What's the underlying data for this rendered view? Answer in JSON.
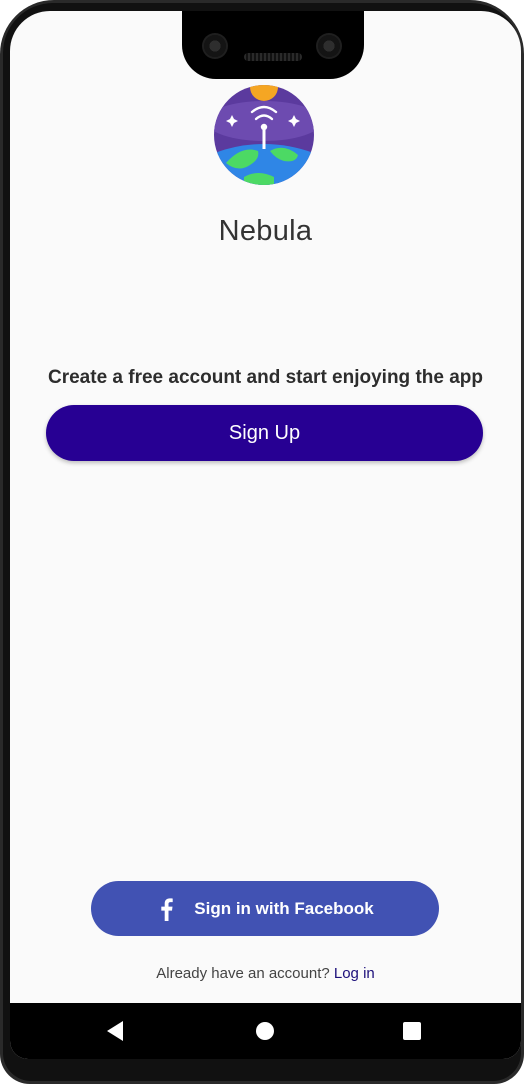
{
  "app": {
    "name": "Nebula",
    "logo_icon": "planet-satellite-logo-icon"
  },
  "main": {
    "tagline": "Create a free account and start enjoying the app",
    "signup_label": "Sign Up"
  },
  "footer": {
    "facebook_label": "Sign in with Facebook",
    "already_text": "Already have an account?",
    "login_label": "Log in"
  },
  "navbar": {
    "back_icon": "back-triangle-icon",
    "home_icon": "home-circle-icon",
    "recent_icon": "recents-square-icon"
  },
  "colors": {
    "primary": "#270093",
    "facebook": "#4152b3",
    "link": "#1c0f7a",
    "background": "#fafafa"
  }
}
